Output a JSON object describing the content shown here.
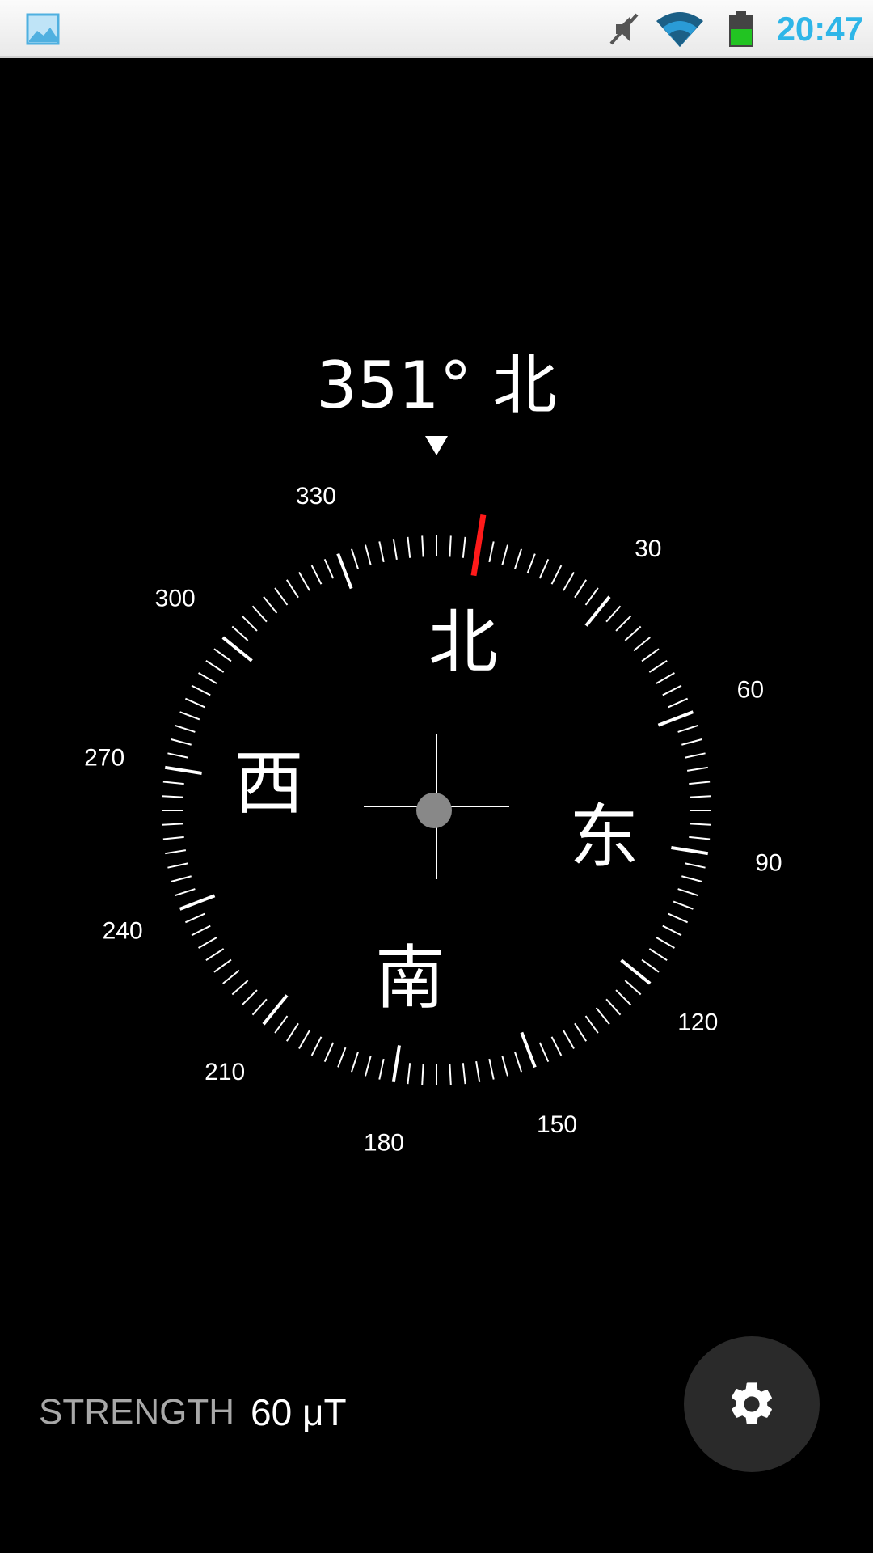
{
  "status_bar": {
    "time": "20:47",
    "icons": [
      "gallery-icon",
      "mute-icon",
      "wifi-icon",
      "battery-icon"
    ],
    "time_color": "#2fb6e8",
    "battery_color": "#22c422"
  },
  "compass": {
    "heading_text": "351° 北",
    "heading_degrees": 351,
    "cardinals": [
      {
        "label": "北",
        "bearing": 0
      },
      {
        "label": "东",
        "bearing": 90
      },
      {
        "label": "南",
        "bearing": 180
      },
      {
        "label": "西",
        "bearing": 270
      }
    ],
    "degree_labels": [
      "30",
      "60",
      "90",
      "120",
      "150",
      "180",
      "210",
      "240",
      "270",
      "300",
      "330"
    ],
    "north_marker_color": "#ff1a1a"
  },
  "footer": {
    "strength_label": "STRENGTH",
    "strength_value": "60 μT"
  },
  "settings": {
    "icon": "gear-icon"
  }
}
